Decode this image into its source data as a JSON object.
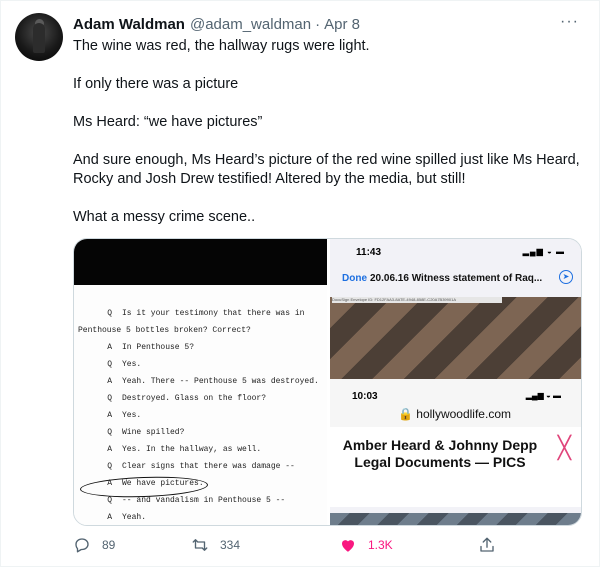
{
  "tweet": {
    "author_name": "Adam Waldman",
    "handle": "@adam_waldman",
    "separator": "·",
    "date": "Apr 8",
    "more_label": "···",
    "paragraphs": [
      "The wine was red, the hallway rugs were light.",
      "If only there was a picture",
      "Ms Heard: “we have pictures”",
      "And sure enough, Ms Heard’s picture of the red wine spilled just like Ms Heard, Rocky and Josh Drew testified! Altered by the media, but still!",
      "What a messy crime scene.."
    ]
  },
  "media_left": {
    "transcript": [
      {
        "qa": "Q",
        "text": "Is it your testimony that there was in"
      },
      {
        "qa": "",
        "text": "Penthouse 5 bottles broken?  Correct?"
      },
      {
        "qa": "A",
        "text": "In Penthouse 5?"
      },
      {
        "qa": "Q",
        "text": "Yes."
      },
      {
        "qa": "A",
        "text": "Yeah.  There -- Penthouse 5 was destroyed."
      },
      {
        "qa": "Q",
        "text": "Destroyed.  Glass on the floor?"
      },
      {
        "qa": "A",
        "text": "Yes."
      },
      {
        "qa": "Q",
        "text": "Wine spilled?"
      },
      {
        "qa": "A",
        "text": "Yes.  In the hallway, as well."
      },
      {
        "qa": "Q",
        "text": "Clear signs that there was damage --"
      },
      {
        "qa": "A",
        "text": "We have pictures."
      },
      {
        "qa": "Q",
        "text": "-- and vandalism in Penthouse 5 --"
      },
      {
        "qa": "A",
        "text": "Yeah."
      }
    ]
  },
  "media_right": {
    "status_time": "11:43",
    "status_icons": "▂▄▆ ◒ ▬",
    "done_label": "Done",
    "doc_title": "20.06.16 Witness statement of Raq...",
    "nav_icon": "compass-icon",
    "nav_icon_glyph": "➤",
    "docusign_banner": "DocuSign Envelope ID: FD12FAA3-8ATE-4948-858E-C20A7B39901A",
    "safari_time": "10:03",
    "safari_icons": "▂▄▆ ◒ ▬",
    "url": "🔒 hollywoodlife.com",
    "headline": "Amber Heard & Johnny Depp Legal Documents — PICS",
    "close_glyph": "╳"
  },
  "actions": {
    "reply_count": "89",
    "retweet_count": "334",
    "like_count": "1.3K",
    "like_color": "#f91880",
    "icon_color": "#536471"
  }
}
